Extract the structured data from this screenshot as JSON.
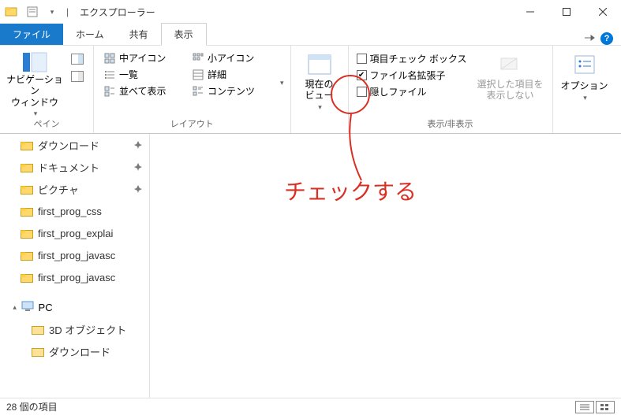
{
  "window": {
    "title": "エクスプローラー"
  },
  "tabs": {
    "file": "ファイル",
    "home": "ホーム",
    "share": "共有",
    "view": "表示"
  },
  "ribbon": {
    "pane": {
      "nav": "ナビゲーション\nウィンドウ",
      "label": "ペイン"
    },
    "layout": {
      "medium": "中アイコン",
      "small": "小アイコン",
      "list": "一覧",
      "details": "詳細",
      "tiles": "並べて表示",
      "content": "コンテンツ",
      "label": "レイアウト"
    },
    "current": {
      "view": "現在の\nビュー"
    },
    "show": {
      "chk_items": "項目チェック ボックス",
      "chk_ext": "ファイル名拡張子",
      "chk_hidden": "隠しファイル",
      "hide_sel": "選択した項目を\n表示しない",
      "label": "表示/非表示"
    },
    "options": {
      "label": "オプション"
    }
  },
  "sidebar": {
    "items": [
      {
        "label": "ダウンロード",
        "pinned": true
      },
      {
        "label": "ドキュメント",
        "pinned": true
      },
      {
        "label": "ピクチャ",
        "pinned": true
      },
      {
        "label": "first_prog_css",
        "pinned": false
      },
      {
        "label": "first_prog_explai",
        "pinned": false
      },
      {
        "label": "first_prog_javasc",
        "pinned": false
      },
      {
        "label": "first_prog_javasc",
        "pinned": false
      }
    ],
    "pc": "PC",
    "pc_items": [
      {
        "label": "3D オブジェクト"
      },
      {
        "label": "ダウンロード"
      }
    ]
  },
  "status": {
    "count": "28 個の項目"
  },
  "annotation": {
    "text": "チェックする"
  }
}
